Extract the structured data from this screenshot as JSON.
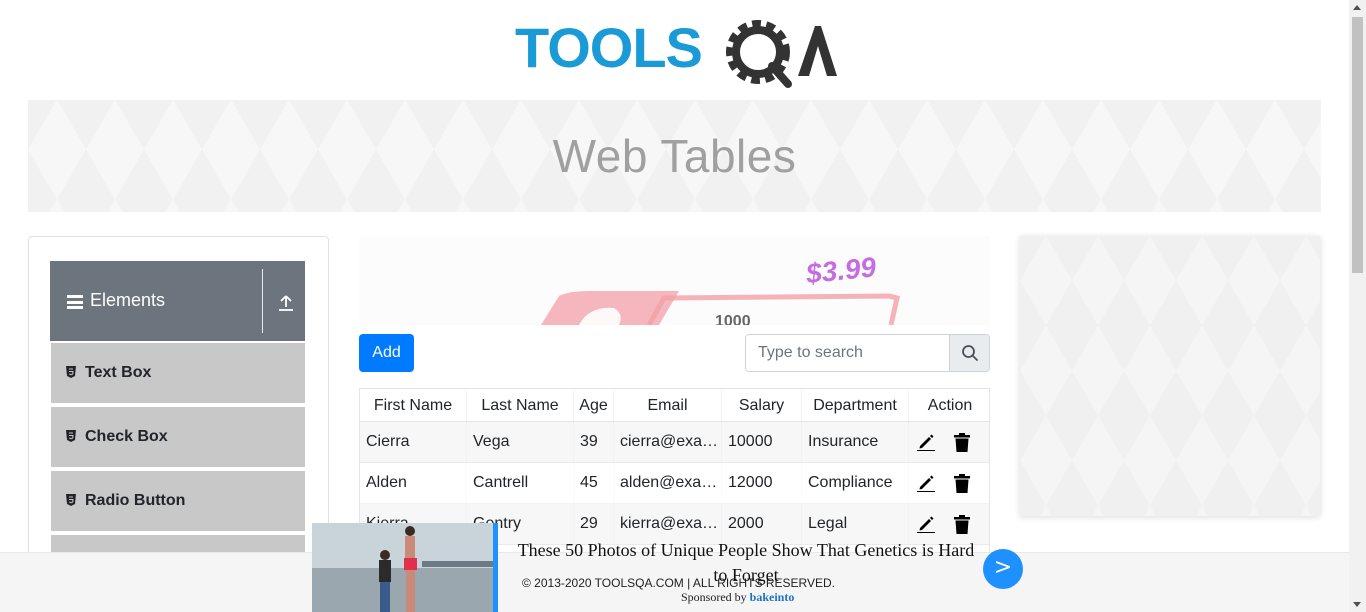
{
  "header": {
    "logo_text": "TOOLSQA"
  },
  "banner": {
    "title": "Web Tables"
  },
  "sidebar": {
    "group_title": "Elements",
    "items": [
      {
        "label": "Text Box"
      },
      {
        "label": "Check Box"
      },
      {
        "label": "Radio Button"
      }
    ]
  },
  "ad_image": {
    "price": "$3.99",
    "count": "1000"
  },
  "toolbar": {
    "add_label": "Add",
    "search_placeholder": "Type to search"
  },
  "table": {
    "columns": [
      "First Name",
      "Last Name",
      "Age",
      "Email",
      "Salary",
      "Department",
      "Action"
    ],
    "rows": [
      {
        "first": "Cierra",
        "last": "Vega",
        "age": "39",
        "email": "cierra@example.com",
        "salary": "10000",
        "department": "Insurance"
      },
      {
        "first": "Alden",
        "last": "Cantrell",
        "age": "45",
        "email": "alden@example.com",
        "salary": "12000",
        "department": "Compliance"
      },
      {
        "first": "Kierra",
        "last": "Gentry",
        "age": "29",
        "email": "kierra@example.com",
        "salary": "2000",
        "department": "Legal"
      }
    ]
  },
  "footer": {
    "copyright": "© 2013-2020 TOOLSQA.COM | ALL RIGHTS RESERVED."
  },
  "bottom_ad": {
    "headline": "These 50 Photos of Unique People Show That Genetics is Hard to Forget",
    "sponsor_prefix": "Sponsored by",
    "sponsor_name": "bakeinto",
    "next_label": ">"
  },
  "colors": {
    "brand_blue": "#1a9bd7",
    "brand_dark": "#333333",
    "primary": "#007bff",
    "sidebar_header": "#6c757d",
    "sidebar_item": "#c8c8c8"
  }
}
